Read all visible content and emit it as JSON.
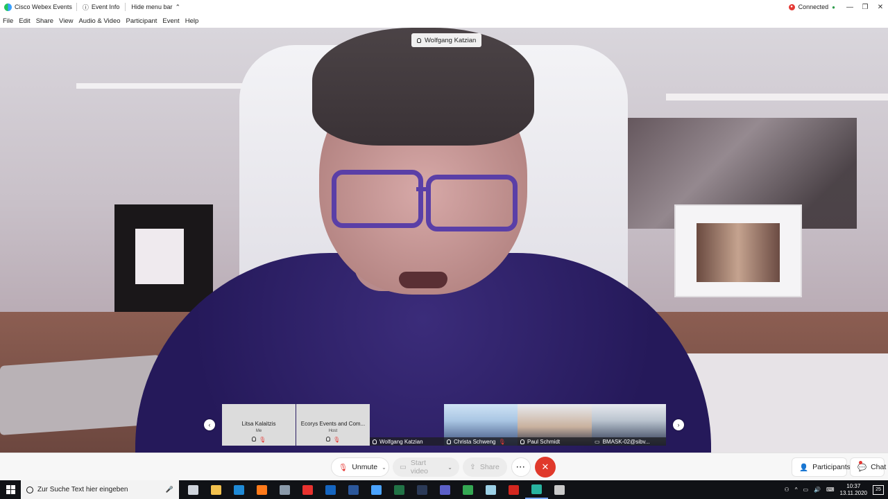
{
  "titlebar": {
    "app_name": "Cisco Webex Events",
    "event_info": "Event Info",
    "hide_menu": "Hide menu bar",
    "connection_status": "Connected",
    "minimize": "—",
    "restore": "❐",
    "close": "✕"
  },
  "menu": {
    "items": [
      "File",
      "Edit",
      "Share",
      "View",
      "Audio & Video",
      "Participant",
      "Event",
      "Help"
    ]
  },
  "stage": {
    "active_speaker": "Wolfgang Katzian"
  },
  "filmstrip": {
    "tiles": [
      {
        "name": "Litsa Kalaitzis",
        "role": "Me"
      },
      {
        "name": "Ecorys Events and Com...",
        "role": "Host"
      },
      {
        "name": "Wolfgang Katzian"
      },
      {
        "name": "Christa Schweng"
      },
      {
        "name": "Paul Schmidt"
      },
      {
        "name": "BMASK-02@sibv..."
      }
    ]
  },
  "controls": {
    "unmute": "Unmute",
    "start_video": "Start video",
    "share": "Share",
    "more": "···",
    "end": "✕",
    "participants": "Participants",
    "chat": "Chat"
  },
  "taskbar": {
    "search_placeholder": "Zur Suche Text hier eingeben",
    "time": "10:37",
    "date": "13.11.2020",
    "notifications": "25",
    "apps": [
      {
        "name": "task-view",
        "color": "#cfd4dc"
      },
      {
        "name": "file-explorer",
        "color": "#f2c14e"
      },
      {
        "name": "edge",
        "color": "#1f8ad6"
      },
      {
        "name": "firefox",
        "color": "#ff7a1a"
      },
      {
        "name": "snipping",
        "color": "#8a9aaa"
      },
      {
        "name": "opera",
        "color": "#e8322f"
      },
      {
        "name": "outlook",
        "color": "#1565c0"
      },
      {
        "name": "word",
        "color": "#2b579a"
      },
      {
        "name": "onedrive",
        "color": "#4aa3ff"
      },
      {
        "name": "excel",
        "color": "#217346"
      },
      {
        "name": "lightroom",
        "color": "#2b3a57"
      },
      {
        "name": "teams",
        "color": "#5b5fc7"
      },
      {
        "name": "chrome",
        "color": "#34a853"
      },
      {
        "name": "notes",
        "color": "#9bd0e6"
      },
      {
        "name": "acrobat",
        "color": "#d3271f"
      },
      {
        "name": "webex",
        "color": "#28b3a0"
      },
      {
        "name": "paint",
        "color": "#c9c9c9"
      }
    ]
  }
}
